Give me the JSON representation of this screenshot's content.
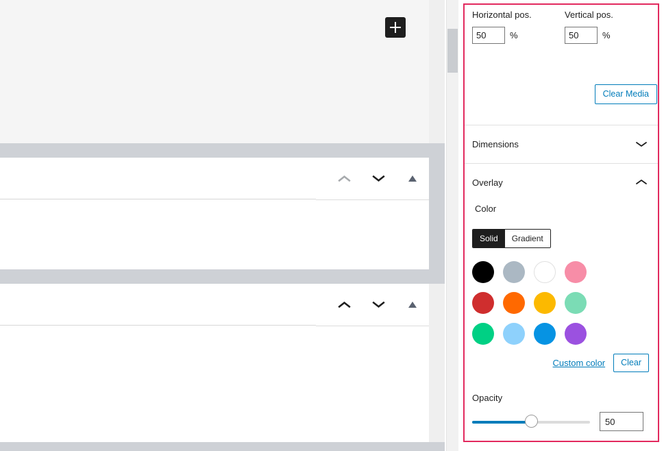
{
  "canvas": {
    "inserter_label": "+",
    "blocks": [
      {
        "toolbar": {
          "move_up_label": "Move up",
          "move_down_label": "Move down",
          "select_parent_label": "Select parent block"
        },
        "move_up_state": "disabled"
      },
      {
        "toolbar": {
          "move_up_label": "Move up",
          "move_down_label": "Move down",
          "select_parent_label": "Select parent block"
        },
        "move_up_state": "enabled"
      }
    ]
  },
  "sidebar": {
    "focus_outline_color": "#e2295e",
    "accent_color": "#007cba",
    "position": {
      "horizontal": {
        "label": "Horizontal pos.",
        "value": "50",
        "unit": "%"
      },
      "vertical": {
        "label": "Vertical pos.",
        "value": "50",
        "unit": "%"
      }
    },
    "clear_media_label": "Clear Media",
    "panels": [
      {
        "title": "Dimensions",
        "expanded": false,
        "chevron": "chevron-down-icon"
      },
      {
        "title": "Overlay",
        "expanded": true,
        "chevron": "chevron-up-icon"
      }
    ],
    "overlay": {
      "color_label": "Color",
      "color_type": {
        "solid_label": "Solid",
        "gradient_label": "Gradient",
        "selected": "Solid"
      },
      "palette": [
        {
          "name": "Black",
          "hex": "#000000"
        },
        {
          "name": "Cyan bluish gray",
          "hex": "#abb8c3"
        },
        {
          "name": "White",
          "hex": "#ffffff"
        },
        {
          "name": "Pale pink",
          "hex": "#f78da7"
        },
        {
          "name": "Vivid red",
          "hex": "#cf2e2e"
        },
        {
          "name": "Luminous vivid orange",
          "hex": "#ff6900"
        },
        {
          "name": "Luminous vivid amber",
          "hex": "#fcb900"
        },
        {
          "name": "Light green cyan",
          "hex": "#7bdcb5"
        },
        {
          "name": "Vivid green cyan",
          "hex": "#00d084"
        },
        {
          "name": "Pale cyan blue",
          "hex": "#8ed1fc"
        },
        {
          "name": "Vivid cyan blue",
          "hex": "#0693e3"
        },
        {
          "name": "Vivid purple",
          "hex": "#9b51e0"
        }
      ],
      "custom_color_label": "Custom color",
      "clear_label": "Clear",
      "opacity": {
        "label": "Opacity",
        "value": "50",
        "min": 0,
        "max": 100
      }
    }
  }
}
